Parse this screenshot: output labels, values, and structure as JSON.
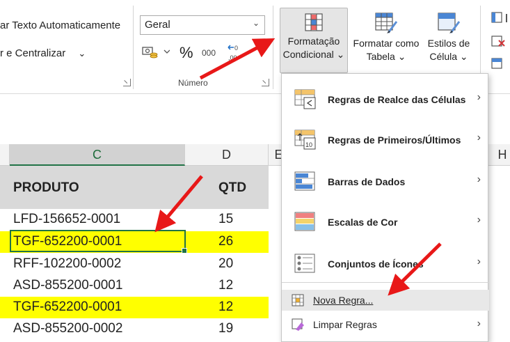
{
  "ribbon": {
    "wrap_text": "ar Texto Automaticamente",
    "merge_center": "r e Centralizar",
    "merge_chevron": "⌄",
    "number_format": "Geral",
    "percent_symbol": "%",
    "thousands_symbol": "000",
    "number_group_label": "Número",
    "conditional_formatting": [
      "Formatação",
      "Condicional ⌄"
    ],
    "format_as_table": [
      "Formatar como",
      "Tabela ⌄"
    ],
    "cell_styles": [
      "Estilos de",
      "Célula ⌄"
    ]
  },
  "columns": {
    "c": "C",
    "d": "D",
    "e": "E",
    "h": "H"
  },
  "table": {
    "header_product": "PRODUTO",
    "header_qty": "QTD",
    "rows": [
      {
        "product": "LFD-156652-0001",
        "qty": "15",
        "highlighted": false
      },
      {
        "product": "TGF-652200-0001",
        "qty": "26",
        "highlighted": true
      },
      {
        "product": "RFF-102200-0002",
        "qty": "20",
        "highlighted": false
      },
      {
        "product": "ASD-855200-0001",
        "qty": "12",
        "highlighted": false
      },
      {
        "product": "TGF-652200-0001",
        "qty": "12",
        "highlighted": true
      },
      {
        "product": "ASD-855200-0002",
        "qty": "19",
        "highlighted": false
      }
    ]
  },
  "menu": {
    "items": [
      {
        "label": "Regras de Realce das Células",
        "icon": "highlight-rules-icon",
        "submenu": true
      },
      {
        "label": "Regras de Primeiros/Últimos",
        "icon": "top-bottom-rules-icon",
        "submenu": true
      },
      {
        "label": "Barras de Dados",
        "icon": "data-bars-icon",
        "submenu": true
      },
      {
        "label": "Escalas de Cor",
        "icon": "color-scales-icon",
        "submenu": true
      },
      {
        "label": "Conjuntos de Ícones",
        "icon": "icon-sets-icon",
        "submenu": true
      }
    ],
    "new_rule": "Nova Regra...",
    "clear_rules": "Limpar Regras",
    "submenu_arrow": "›"
  },
  "colors": {
    "highlight": "#ffff00",
    "header_fill": "#d9d9d9",
    "excel_green": "#217346",
    "arrow_red": "#e81818"
  }
}
